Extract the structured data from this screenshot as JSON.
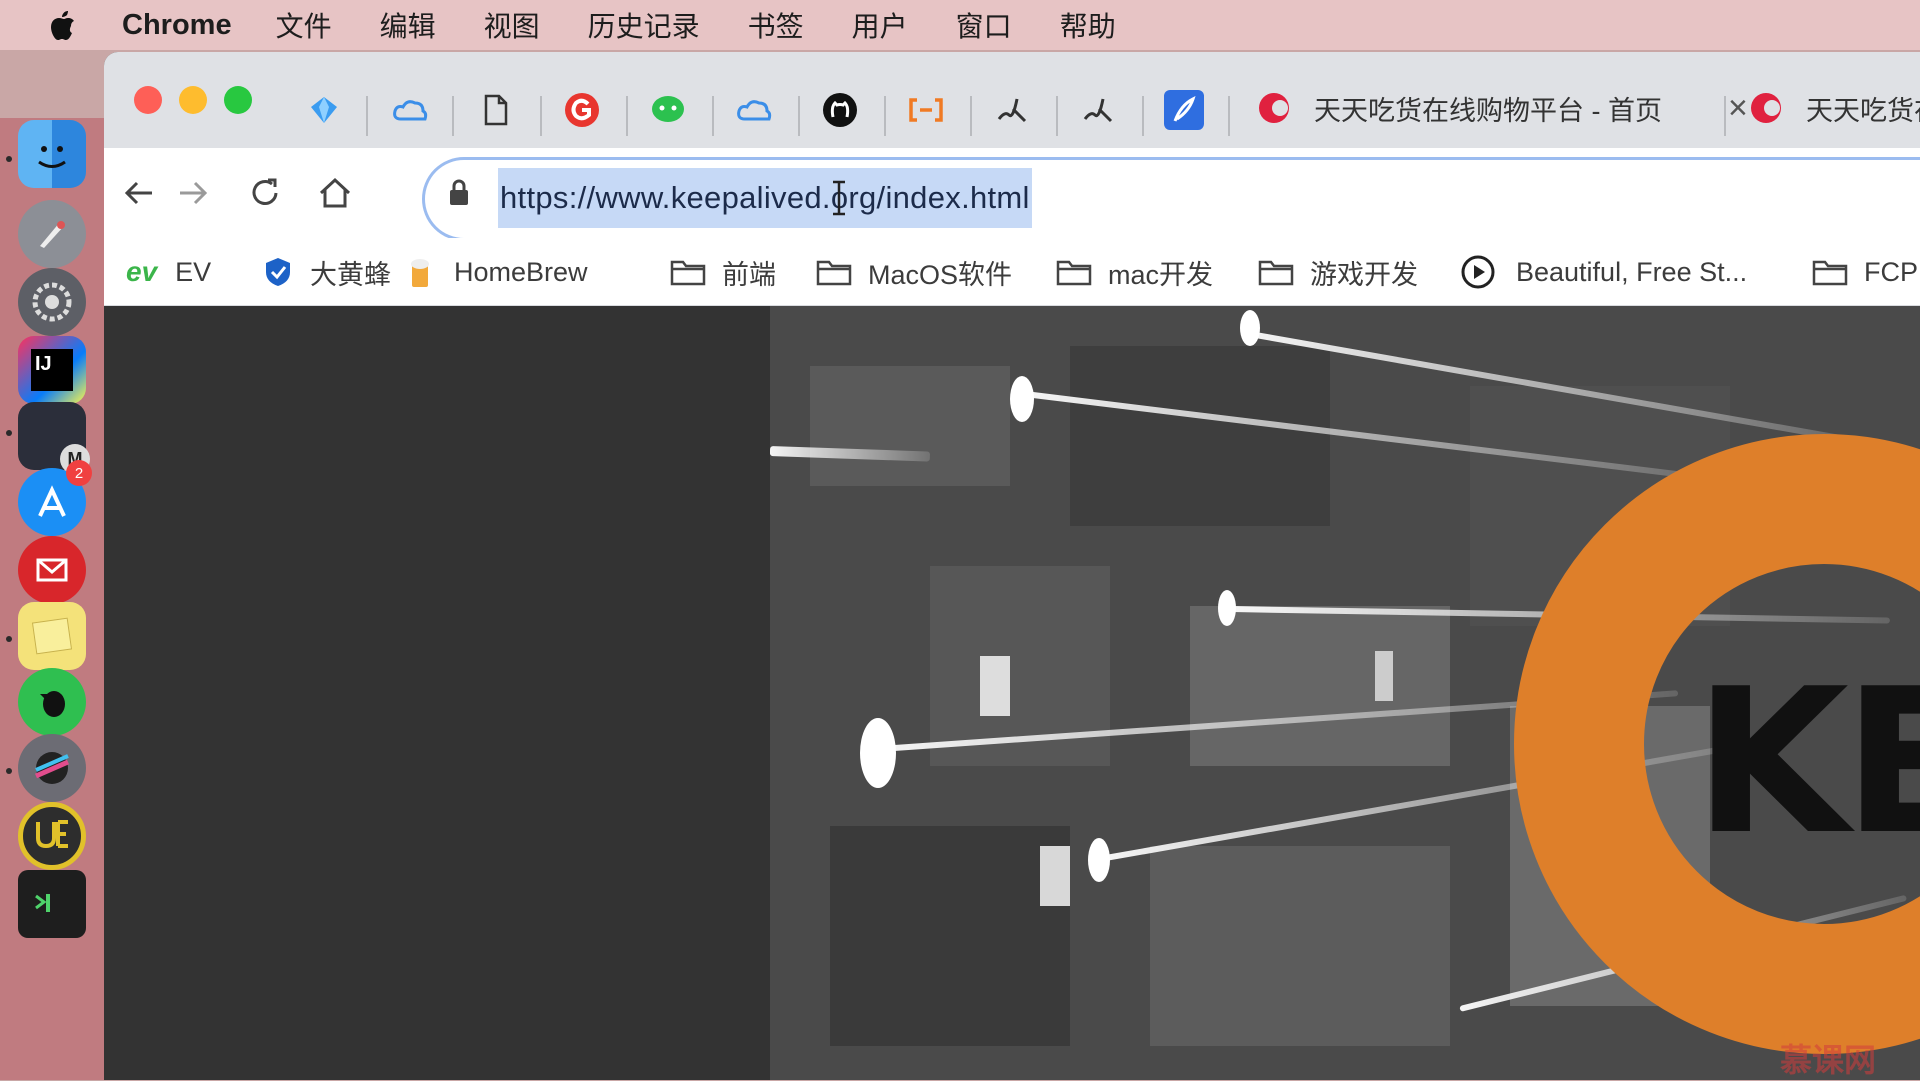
{
  "menubar": {
    "app_name": "Chrome",
    "items": [
      "文件",
      "编辑",
      "视图",
      "历史记录",
      "书签",
      "用户",
      "窗口",
      "帮助"
    ]
  },
  "dock": {
    "items": [
      "finder-icon",
      "launchpad-icon",
      "system-preferences-icon",
      "intellij-idea-icon",
      "mweb-icon",
      "app-store-icon",
      "mail-icon",
      "stickies-icon",
      "evernote-icon",
      "final-cut-pro-icon",
      "ultraedit-icon",
      "terminal-icon"
    ],
    "app_store_badge": "2"
  },
  "tabs": [
    {
      "title": "天天吃货在线购物平台 - 首页",
      "close": "×"
    },
    {
      "title": "天天吃货在线购物平台 - 首页"
    }
  ],
  "toolbar": {
    "url": "https://www.keepalived.org/index.html"
  },
  "bookmarks": [
    {
      "icon": "ev-icon",
      "label": "EV"
    },
    {
      "icon": "shield-icon",
      "label": "大黄蜂"
    },
    {
      "icon": "beer-icon",
      "label": "HomeBrew"
    },
    {
      "icon": "folder-icon",
      "label": "前端"
    },
    {
      "icon": "folder-icon",
      "label": "MacOS软件"
    },
    {
      "icon": "folder-icon",
      "label": "mac开发"
    },
    {
      "icon": "folder-icon",
      "label": "游戏开发"
    },
    {
      "icon": "record-icon",
      "label": "Beautiful, Free St..."
    },
    {
      "icon": "folder-icon",
      "label": "FCP"
    }
  ],
  "page": {
    "logo_text": "KE"
  },
  "watermark": "慕课网",
  "colors": {
    "accent": "#de7f2a",
    "url_highlight": "#c6d9f6"
  }
}
